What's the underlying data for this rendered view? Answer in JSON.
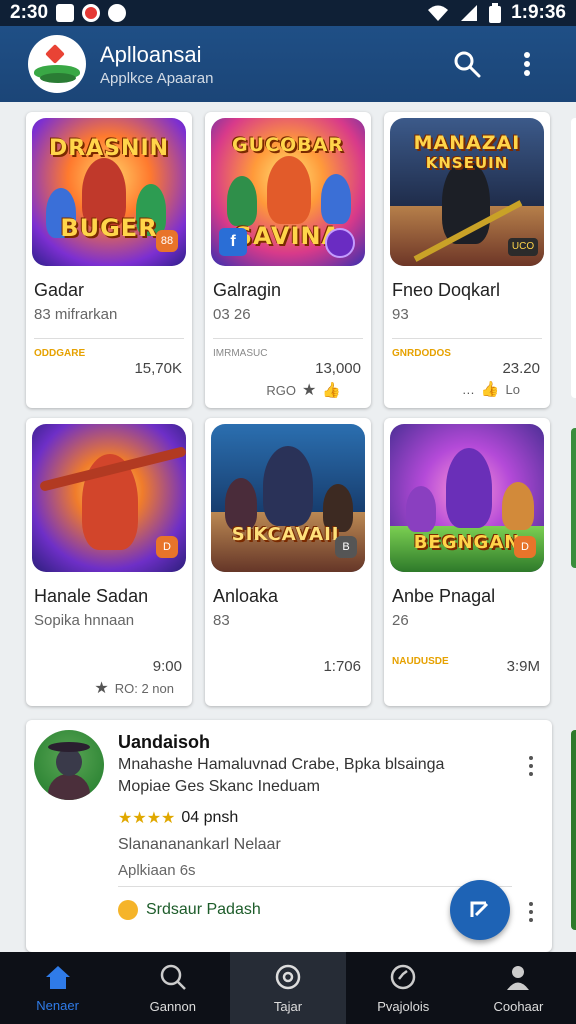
{
  "status_bar": {
    "time": "2:30",
    "right_time": "1:9:36"
  },
  "app_bar": {
    "title": "Aplloansai",
    "subtitle": "Applkce Apaaran",
    "search_icon": "search-icon",
    "menu_icon": "more-vert-icon"
  },
  "row1": [
    {
      "name": "Gadar",
      "sub": "83 mifrarkan",
      "tag": "ODDGARE",
      "value": "15,70K",
      "meta": "",
      "thumb_title": "DRASNIN",
      "thumb_title2": "BUGER",
      "badge": "88",
      "thumb_badge": ""
    },
    {
      "name": "Galragin",
      "sub": "03 26",
      "tag": "IMRMASUC",
      "value": "13,000",
      "meta": "RGO",
      "thumb_title": "GUCOBAR",
      "thumb_title2": "SAVINA",
      "badge": "",
      "thumb_badge": "f"
    },
    {
      "name": "Fneo Doqkarl",
      "sub": "93",
      "tag": "GNRDODOS",
      "value": "23.20",
      "meta": "Lo",
      "thumb_title": "MANAZAI",
      "thumb_title2": "KNSEUIN",
      "badge": "UCO",
      "thumb_badge": ""
    }
  ],
  "row2": [
    {
      "name": "Hanale Sadan",
      "sub": "Sopika hnnaan",
      "tag": "",
      "value": "9:00",
      "meta": "RO: 2 non",
      "thumb_title": "",
      "thumb_title2": "",
      "badge": "D",
      "thumb_badge": ""
    },
    {
      "name": "Anloaka",
      "sub": "83",
      "tag": "",
      "value": "1:706",
      "meta": "",
      "thumb_title": "",
      "thumb_title2": "SIKCAVAIL",
      "badge": "B",
      "thumb_badge": ""
    },
    {
      "name": "Anbe Pnagal",
      "sub": "26",
      "tag": "NAUDUSDE",
      "value": "3:9M",
      "meta": "",
      "thumb_title": "",
      "thumb_title2": "BEGNGAN",
      "badge": "D",
      "thumb_badge": ""
    }
  ],
  "review": {
    "name": "Uandaisoh",
    "line1": "Mnahashe Hamaluvnad Crabe, Bpka blsainga",
    "line2": "Mopiae Ges Skanc Ineduam",
    "stars": "★★★★",
    "rating_text": "04 pnsh",
    "line3": "Slanananankarl Nelaar",
    "line4": "Aplkiaan 6s",
    "action": "Srdsaur Padash"
  },
  "nav": [
    {
      "label": "Nenaer",
      "icon": "home-icon",
      "active": true
    },
    {
      "label": "Gannon",
      "icon": "search-icon",
      "active": false
    },
    {
      "label": "Tajar",
      "icon": "circle-icon",
      "active": false
    },
    {
      "label": "Pvajolois",
      "icon": "heart-icon",
      "active": false
    },
    {
      "label": "Coohaar",
      "icon": "person-icon",
      "active": false
    }
  ]
}
